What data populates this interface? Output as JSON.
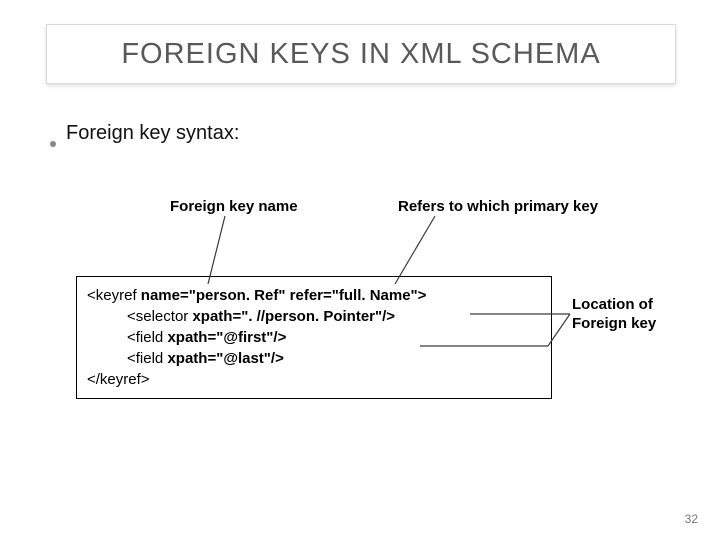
{
  "title": "FOREIGN KEYS IN XML SCHEMA",
  "bullet": "Foreign key syntax:",
  "labels": {
    "fk_name": "Foreign key name",
    "refers": "Refers to which primary key",
    "location_l1": "Location of",
    "location_l2": "Foreign key"
  },
  "code": {
    "l1a": "<keyref ",
    "l1b": "name=\"person. Ref\" ",
    "l1c": "refer=\"full. Name\">",
    "l2a": "<selector ",
    "l2b": "xpath=\". //person. Pointer\"/>",
    "l3a": "<field ",
    "l3b": "xpath=\"@first\"/>",
    "l4a": "<field ",
    "l4b": "xpath=\"@last\"/>",
    "l5": "</keyref>"
  },
  "page_number": "32"
}
